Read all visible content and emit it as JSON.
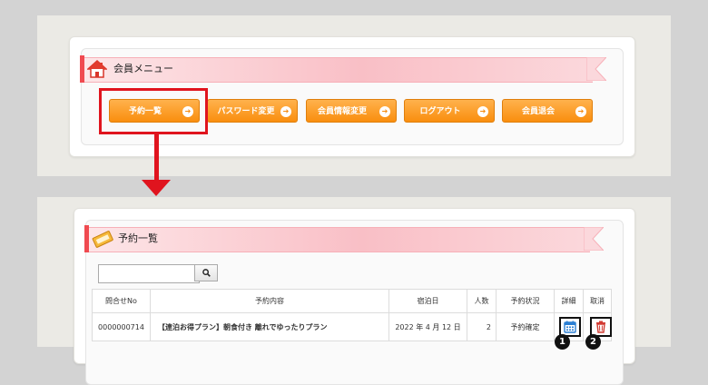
{
  "member_menu": {
    "title": "会員メニュー",
    "buttons": [
      {
        "label": "予約一覧",
        "arrow": "➔"
      },
      {
        "label": "パスワード変更",
        "arrow": "➔"
      },
      {
        "label": "会員情報変更",
        "arrow": "➔"
      },
      {
        "label": "ログアウト",
        "arrow": "➔"
      },
      {
        "label": "会員退会",
        "arrow": "➔"
      }
    ],
    "highlight_color": "#e0141e"
  },
  "reservation_list": {
    "title": "予約一覧",
    "search": {
      "value": "",
      "button_icon": "search-icon"
    },
    "columns": [
      "問合せNo",
      "予約内容",
      "宿泊日",
      "人数",
      "予約状況",
      "詳細",
      "取消"
    ],
    "rows": [
      {
        "no": "0000000714",
        "content": "【連泊お得プラン】朝食付き 離れでゆったりプラン",
        "date": "2022 年 4 月 12 日",
        "people": "2",
        "status": "予約確定"
      }
    ],
    "markers": [
      "1",
      "2"
    ]
  },
  "colors": {
    "accent": "#f98e0e",
    "ribbon": "#f9bfc6",
    "flag": "#f04a50",
    "detail_icon": "#2a7fd4",
    "cancel_icon": "#d23b32"
  }
}
